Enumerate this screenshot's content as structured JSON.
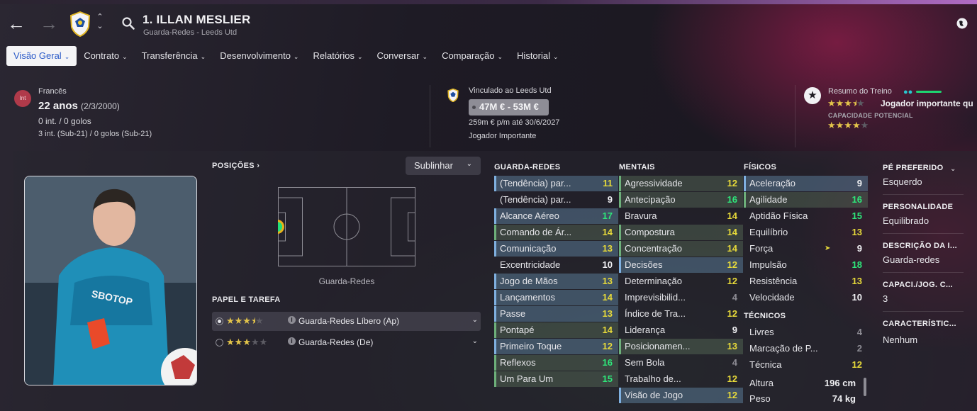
{
  "header": {
    "player_name": "1. ILLAN MESLIER",
    "subtitle": "Guarda-Redes - Leeds Utd"
  },
  "tabs": [
    {
      "label": "Visão Geral",
      "active": true
    },
    {
      "label": "Contrato"
    },
    {
      "label": "Transferência"
    },
    {
      "label": "Desenvolvimento"
    },
    {
      "label": "Relatórios"
    },
    {
      "label": "Conversar"
    },
    {
      "label": "Comparação"
    },
    {
      "label": "Historial"
    }
  ],
  "info": {
    "flag_abbrev": "Int",
    "nationality": "Francês",
    "age": "22 anos",
    "dob": "(2/3/2000)",
    "caps": "0 int. / 0 golos",
    "caps_u21": "3 int. (Sub-21) / 0 golos (Sub-21)",
    "contract_club": "Vinculado ao Leeds Utd",
    "value": "47M € - 53M €",
    "wage": "259m € p/m até 30/6/2027",
    "squad_status": "Jogador Importante",
    "training_summary": "Resumo do Treino",
    "current_ability_stars": 3.5,
    "role_importance": "Jogador importante qu",
    "potential_label": "CAPACIDADE POTENCIAL",
    "potential_stars": 4
  },
  "positions": {
    "label": "POSIÇÕES",
    "highlight_button": "Sublinhar",
    "position_name": "Guarda-Redes"
  },
  "roles": {
    "label": "PAPEL E TAREFA",
    "items": [
      {
        "name": "Guarda-Redes Líbero (Ap)",
        "stars": 3.5,
        "selected": true
      },
      {
        "name": "Guarda-Redes (De)",
        "stars": 3,
        "selected": false
      }
    ]
  },
  "goalkeeping": {
    "label": "GUARDA-REDES",
    "attributes": [
      {
        "name": "(Tendência) par...",
        "value": "11"
      },
      {
        "name": "(Tendência) par...",
        "value": "9"
      },
      {
        "name": "Alcance Aéreo",
        "value": "17"
      },
      {
        "name": "Comando de Ár...",
        "value": "14"
      },
      {
        "name": "Comunicação",
        "value": "13"
      },
      {
        "name": "Excentricidade",
        "value": "10"
      },
      {
        "name": "Jogo de Mãos",
        "value": "13"
      },
      {
        "name": "Lançamentos",
        "value": "14"
      },
      {
        "name": "Passe",
        "value": "13"
      },
      {
        "name": "Pontapé",
        "value": "14"
      },
      {
        "name": "Primeiro Toque",
        "value": "12"
      },
      {
        "name": "Reflexos",
        "value": "16"
      },
      {
        "name": "Um Para Um",
        "value": "15"
      }
    ]
  },
  "mental": {
    "label": "MENTAIS",
    "attributes": [
      {
        "name": "Agressividade",
        "value": "12"
      },
      {
        "name": "Antecipação",
        "value": "16"
      },
      {
        "name": "Bravura",
        "value": "14"
      },
      {
        "name": "Compostura",
        "value": "14"
      },
      {
        "name": "Concentração",
        "value": "14"
      },
      {
        "name": "Decisões",
        "value": "12"
      },
      {
        "name": "Determinação",
        "value": "12"
      },
      {
        "name": "Imprevisibilid...",
        "value": "4"
      },
      {
        "name": "Índice de Tra...",
        "value": "12"
      },
      {
        "name": "Liderança",
        "value": "9"
      },
      {
        "name": "Posicionamen...",
        "value": "13"
      },
      {
        "name": "Sem Bola",
        "value": "4"
      },
      {
        "name": "Trabalho de...",
        "value": "12"
      },
      {
        "name": "Visão de Jogo",
        "value": "12"
      }
    ]
  },
  "physical": {
    "label": "FÍSICOS",
    "attributes": [
      {
        "name": "Aceleração",
        "value": "9"
      },
      {
        "name": "Agilidade",
        "value": "16"
      },
      {
        "name": "Aptidão Física",
        "value": "15"
      },
      {
        "name": "Equilíbrio",
        "value": "13"
      },
      {
        "name": "Força",
        "value": "9"
      },
      {
        "name": "Impulsão",
        "value": "18"
      },
      {
        "name": "Resistência",
        "value": "13"
      },
      {
        "name": "Velocidade",
        "value": "10"
      }
    ]
  },
  "technical": {
    "label": "TÉCNICOS",
    "attributes": [
      {
        "name": "Livres",
        "value": "4"
      },
      {
        "name": "Marcação de P...",
        "value": "2"
      },
      {
        "name": "Técnica",
        "value": "12"
      }
    ]
  },
  "body": {
    "height_label": "Altura",
    "height": "196 cm",
    "weight_label": "Peso",
    "weight": "74 kg"
  },
  "details": [
    {
      "label": "PÉ PREFERIDO",
      "value": "Esquerdo"
    },
    {
      "label": "PERSONALIDADE",
      "value": "Equilibrado"
    },
    {
      "label": "DESCRIÇÃO DA I...",
      "value": "Guarda-redes"
    },
    {
      "label": "CAPACI./JOG. C...",
      "value": "3"
    },
    {
      "label": "CARACTERÍSTIC...",
      "value": "Nenhum"
    }
  ],
  "colors": {
    "accent": "#2a5ac8",
    "good": "#2ee67a",
    "average": "#e6d93a",
    "poor": "#8d8c94"
  }
}
